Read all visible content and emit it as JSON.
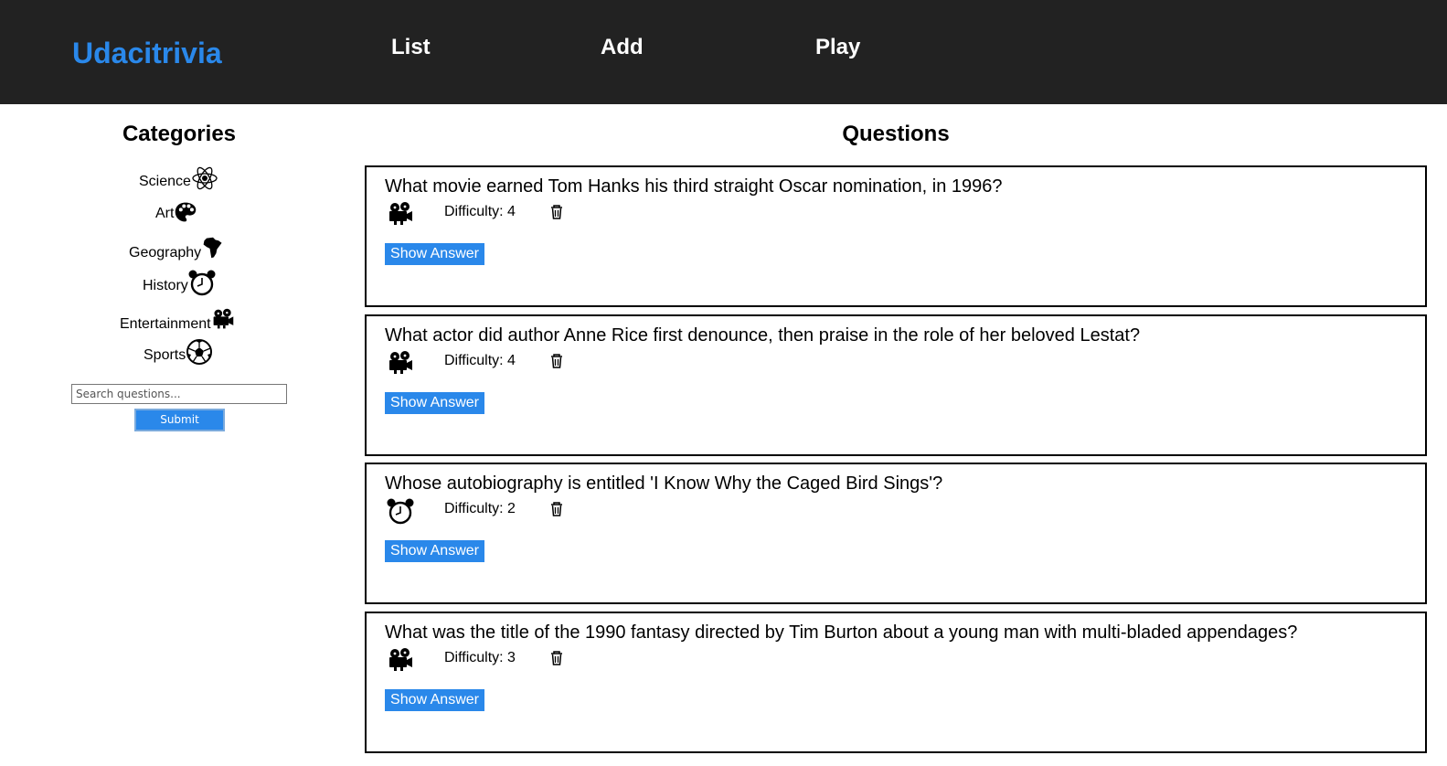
{
  "header": {
    "brand": "Udacitrivia",
    "nav": [
      "List",
      "Add",
      "Play"
    ]
  },
  "categories": {
    "title": "Categories",
    "items": [
      {
        "label": "Science",
        "icon": "atom-icon"
      },
      {
        "label": "Art",
        "icon": "palette-icon"
      },
      {
        "label": "Geography",
        "icon": "africa-map-icon"
      },
      {
        "label": "History",
        "icon": "alarm-clock-icon"
      },
      {
        "label": "Entertainment",
        "icon": "film-projector-icon"
      },
      {
        "label": "Sports",
        "icon": "soccer-ball-icon"
      }
    ],
    "search_placeholder": "Search questions...",
    "submit_label": "Submit"
  },
  "questions": {
    "title": "Questions",
    "items": [
      {
        "text": "What movie earned Tom Hanks his third straight Oscar nomination, in 1996?",
        "difficulty": "Difficulty: 4",
        "category_icon": "film-projector-icon",
        "button": "Show Answer"
      },
      {
        "text": "What actor did author Anne Rice first denounce, then praise in the role of her beloved Lestat?",
        "difficulty": "Difficulty: 4",
        "category_icon": "film-projector-icon",
        "button": "Show Answer"
      },
      {
        "text": "Whose autobiography is entitled 'I Know Why the Caged Bird Sings'?",
        "difficulty": "Difficulty: 2",
        "category_icon": "alarm-clock-icon",
        "button": "Show Answer"
      },
      {
        "text": "What was the title of the 1990 fantasy directed by Tim Burton about a young man with multi-bladed appendages?",
        "difficulty": "Difficulty: 3",
        "category_icon": "film-projector-icon",
        "button": "Show Answer"
      }
    ]
  },
  "colors": {
    "header_bg": "#222222",
    "accent": "#2a88ea"
  }
}
